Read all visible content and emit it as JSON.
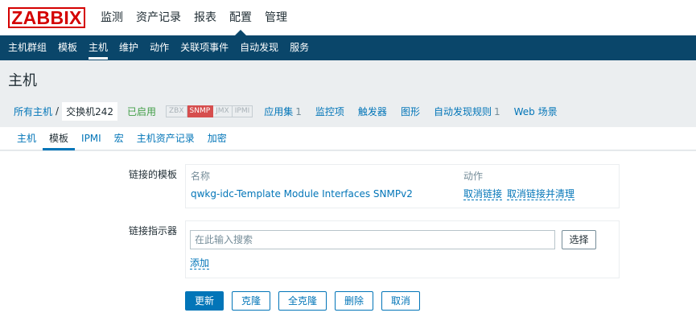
{
  "logo": "ZABBIX",
  "top_menu": [
    "监测",
    "资产记录",
    "报表",
    "配置",
    "管理"
  ],
  "sub_menu": [
    "主机群组",
    "模板",
    "主机",
    "维护",
    "动作",
    "关联项事件",
    "自动发现",
    "服务"
  ],
  "page_title": "主机",
  "breadcrumb": {
    "all_hosts": "所有主机",
    "separator": "/",
    "current_host": "交换机242",
    "status": "已启用",
    "availability": [
      "ZBX",
      "SNMP",
      "JMX",
      "IPMI"
    ],
    "nav": [
      {
        "label": "应用集",
        "count": "1"
      },
      {
        "label": "监控项",
        "count": ""
      },
      {
        "label": "触发器",
        "count": ""
      },
      {
        "label": "图形",
        "count": ""
      },
      {
        "label": "自动发现规则",
        "count": "1"
      },
      {
        "label": "Web 场景",
        "count": ""
      }
    ]
  },
  "tabs": [
    "主机",
    "模板",
    "IPMI",
    "宏",
    "主机资产记录",
    "加密"
  ],
  "form": {
    "linked_templates_label": "链接的模板",
    "col_name": "名称",
    "col_action": "动作",
    "template_name": "qwkg-idc-Template Module Interfaces SNMPv2",
    "unlink": "取消链接",
    "unlink_clear": "取消链接并清理",
    "link_indicator_label": "链接指示器",
    "search_placeholder": "在此输入搜索",
    "select": "选择",
    "add": "添加"
  },
  "buttons": [
    "更新",
    "克隆",
    "全克隆",
    "删除",
    "取消"
  ],
  "colors": {
    "nav_bg": "#0a466a",
    "link": "#0275b8",
    "enabled": "#429e47",
    "snmp_available": "#d64e4e",
    "logo": "#d40000"
  }
}
